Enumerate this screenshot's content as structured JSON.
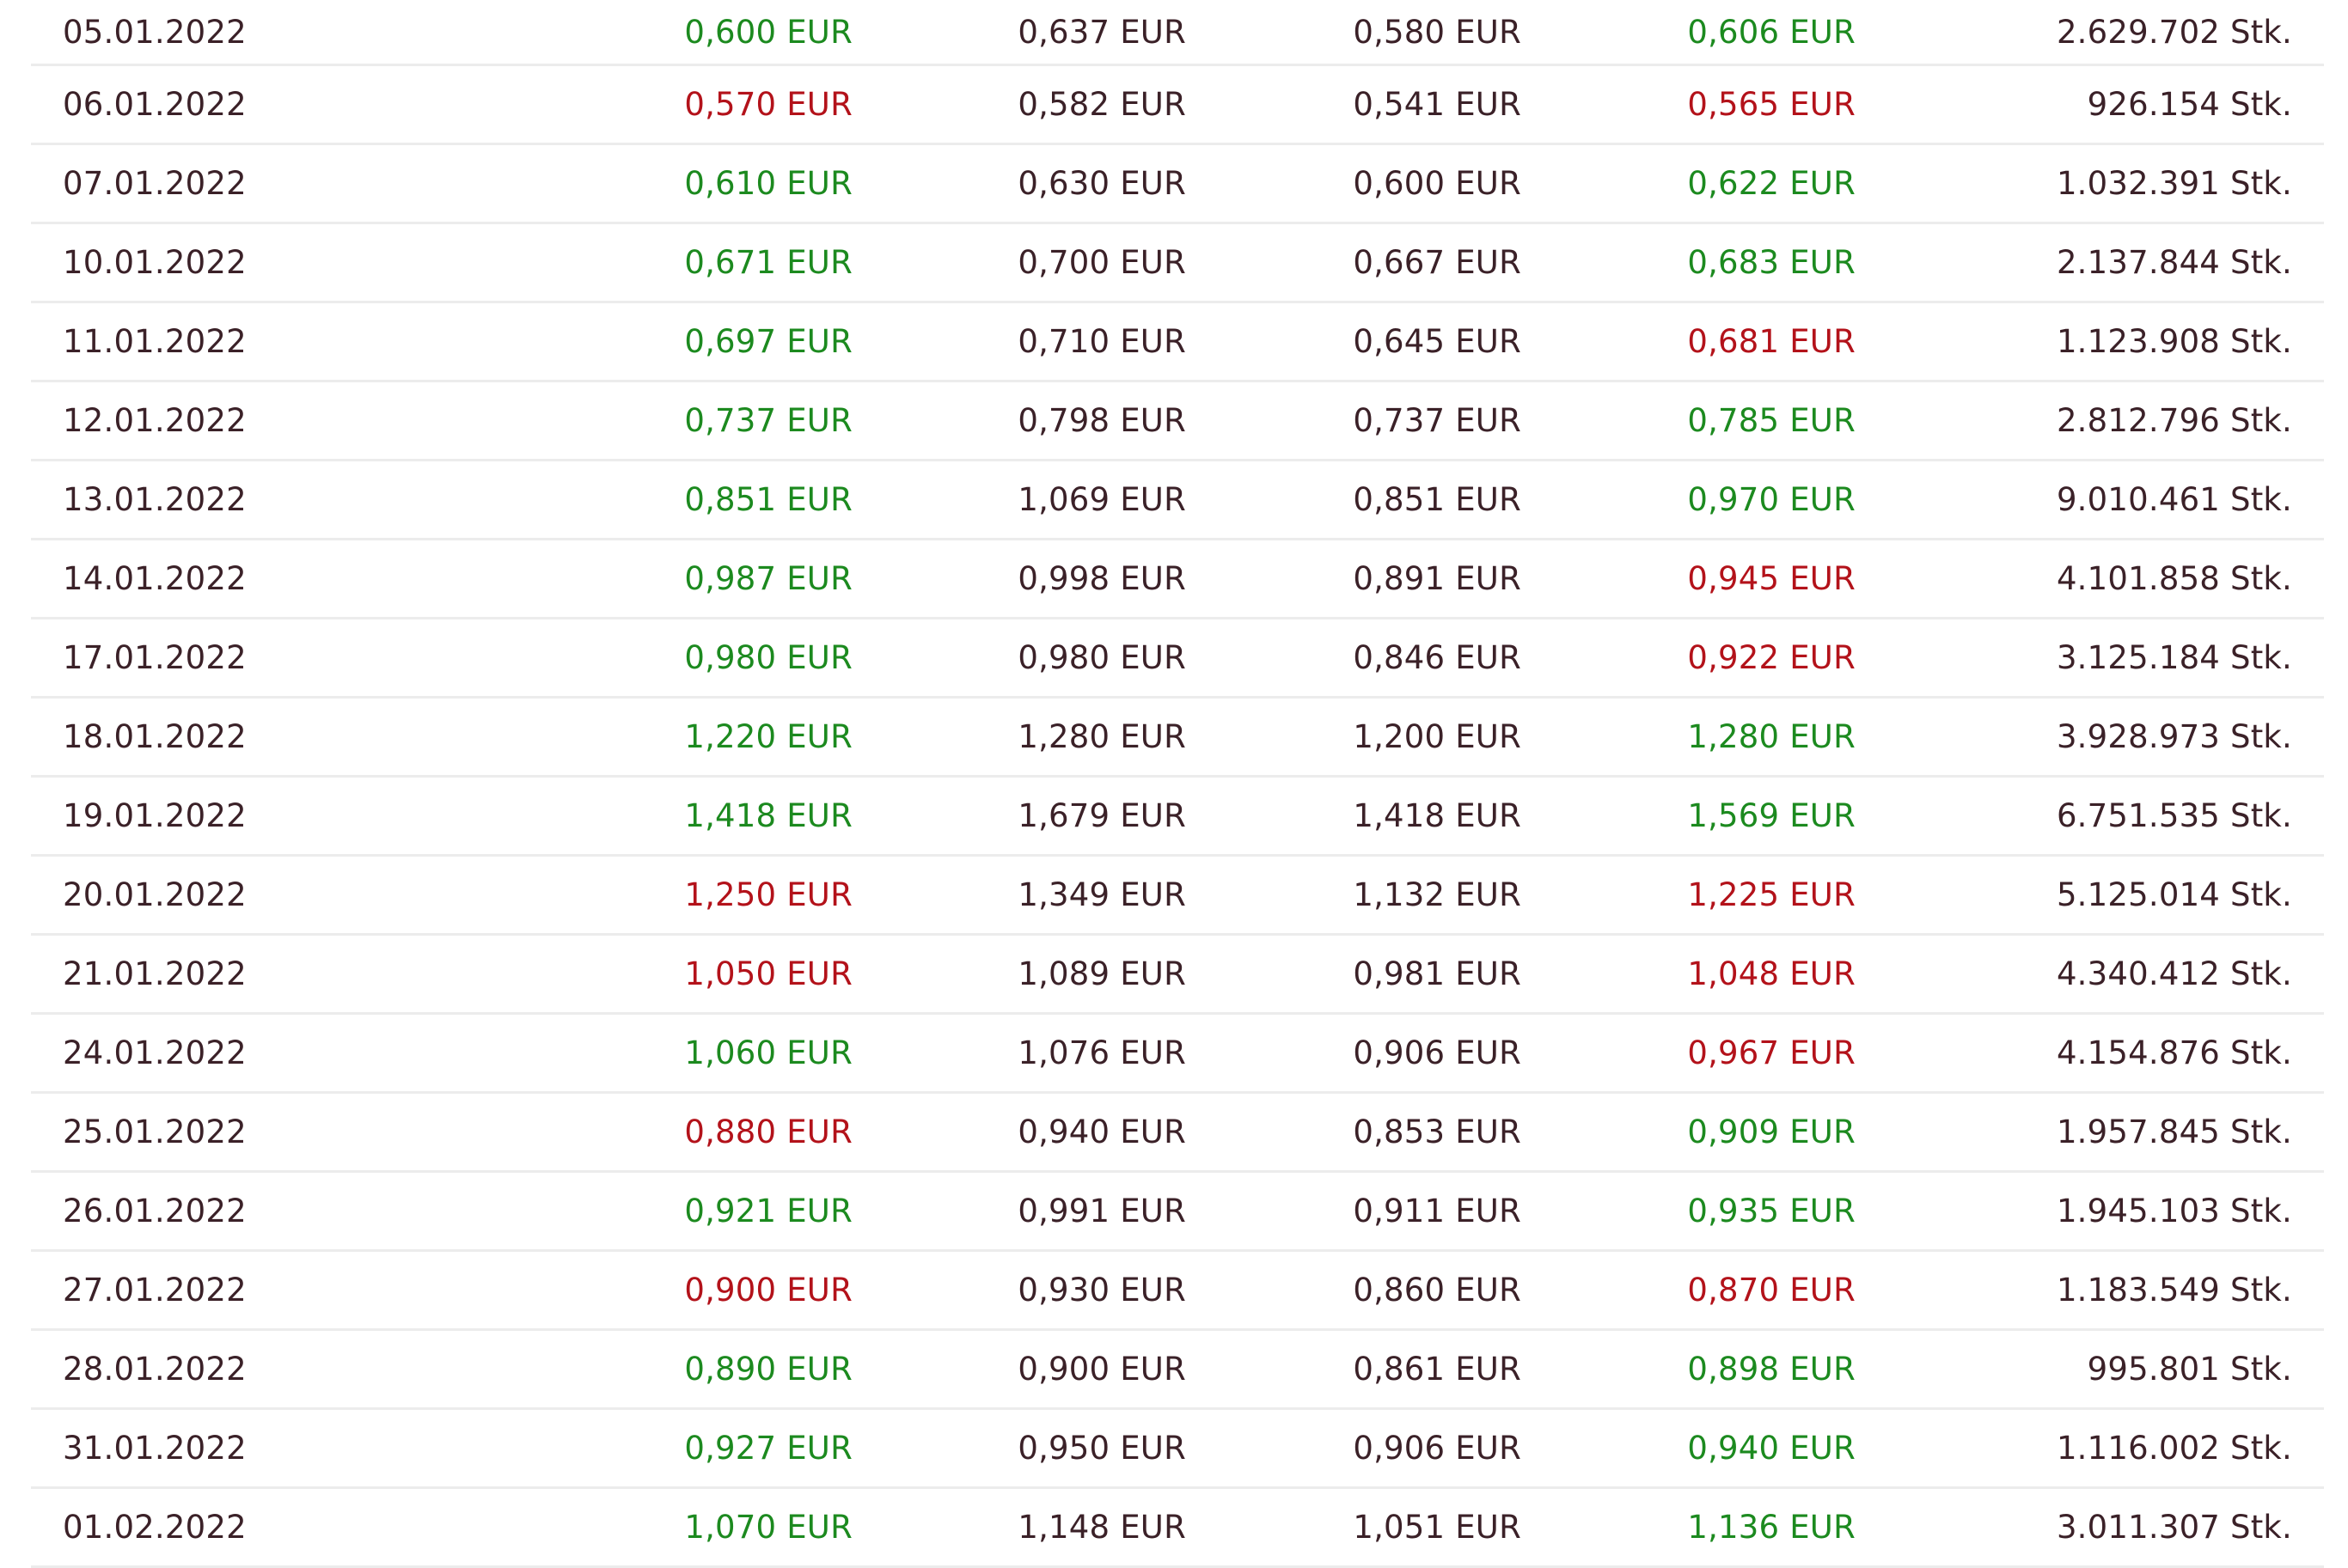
{
  "colors": {
    "positive": "#1c8a1f",
    "negative": "#b3121a",
    "text": "#3b2128",
    "divider": "#ececec"
  },
  "rows": [
    {
      "date": "05.01.2022",
      "open": "0,600 EUR",
      "open_trend": "up",
      "high": "0,637 EUR",
      "low": "0,580 EUR",
      "close": "0,606 EUR",
      "close_trend": "up",
      "volume": "2.629.702 Stk."
    },
    {
      "date": "06.01.2022",
      "open": "0,570 EUR",
      "open_trend": "down",
      "high": "0,582 EUR",
      "low": "0,541 EUR",
      "close": "0,565 EUR",
      "close_trend": "down",
      "volume": "926.154 Stk."
    },
    {
      "date": "07.01.2022",
      "open": "0,610 EUR",
      "open_trend": "up",
      "high": "0,630 EUR",
      "low": "0,600 EUR",
      "close": "0,622 EUR",
      "close_trend": "up",
      "volume": "1.032.391 Stk."
    },
    {
      "date": "10.01.2022",
      "open": "0,671 EUR",
      "open_trend": "up",
      "high": "0,700 EUR",
      "low": "0,667 EUR",
      "close": "0,683 EUR",
      "close_trend": "up",
      "volume": "2.137.844 Stk."
    },
    {
      "date": "11.01.2022",
      "open": "0,697 EUR",
      "open_trend": "up",
      "high": "0,710 EUR",
      "low": "0,645 EUR",
      "close": "0,681 EUR",
      "close_trend": "down",
      "volume": "1.123.908 Stk."
    },
    {
      "date": "12.01.2022",
      "open": "0,737 EUR",
      "open_trend": "up",
      "high": "0,798 EUR",
      "low": "0,737 EUR",
      "close": "0,785 EUR",
      "close_trend": "up",
      "volume": "2.812.796 Stk."
    },
    {
      "date": "13.01.2022",
      "open": "0,851 EUR",
      "open_trend": "up",
      "high": "1,069 EUR",
      "low": "0,851 EUR",
      "close": "0,970 EUR",
      "close_trend": "up",
      "volume": "9.010.461 Stk."
    },
    {
      "date": "14.01.2022",
      "open": "0,987 EUR",
      "open_trend": "up",
      "high": "0,998 EUR",
      "low": "0,891 EUR",
      "close": "0,945 EUR",
      "close_trend": "down",
      "volume": "4.101.858 Stk."
    },
    {
      "date": "17.01.2022",
      "open": "0,980 EUR",
      "open_trend": "up",
      "high": "0,980 EUR",
      "low": "0,846 EUR",
      "close": "0,922 EUR",
      "close_trend": "down",
      "volume": "3.125.184 Stk."
    },
    {
      "date": "18.01.2022",
      "open": "1,220 EUR",
      "open_trend": "up",
      "high": "1,280 EUR",
      "low": "1,200 EUR",
      "close": "1,280 EUR",
      "close_trend": "up",
      "volume": "3.928.973 Stk."
    },
    {
      "date": "19.01.2022",
      "open": "1,418 EUR",
      "open_trend": "up",
      "high": "1,679 EUR",
      "low": "1,418 EUR",
      "close": "1,569 EUR",
      "close_trend": "up",
      "volume": "6.751.535 Stk."
    },
    {
      "date": "20.01.2022",
      "open": "1,250 EUR",
      "open_trend": "down",
      "high": "1,349 EUR",
      "low": "1,132 EUR",
      "close": "1,225 EUR",
      "close_trend": "down",
      "volume": "5.125.014 Stk."
    },
    {
      "date": "21.01.2022",
      "open": "1,050 EUR",
      "open_trend": "down",
      "high": "1,089 EUR",
      "low": "0,981 EUR",
      "close": "1,048 EUR",
      "close_trend": "down",
      "volume": "4.340.412 Stk."
    },
    {
      "date": "24.01.2022",
      "open": "1,060 EUR",
      "open_trend": "up",
      "high": "1,076 EUR",
      "low": "0,906 EUR",
      "close": "0,967 EUR",
      "close_trend": "down",
      "volume": "4.154.876 Stk."
    },
    {
      "date": "25.01.2022",
      "open": "0,880 EUR",
      "open_trend": "down",
      "high": "0,940 EUR",
      "low": "0,853 EUR",
      "close": "0,909 EUR",
      "close_trend": "up",
      "volume": "1.957.845 Stk."
    },
    {
      "date": "26.01.2022",
      "open": "0,921 EUR",
      "open_trend": "up",
      "high": "0,991 EUR",
      "low": "0,911 EUR",
      "close": "0,935 EUR",
      "close_trend": "up",
      "volume": "1.945.103 Stk."
    },
    {
      "date": "27.01.2022",
      "open": "0,900 EUR",
      "open_trend": "down",
      "high": "0,930 EUR",
      "low": "0,860 EUR",
      "close": "0,870 EUR",
      "close_trend": "down",
      "volume": "1.183.549 Stk."
    },
    {
      "date": "28.01.2022",
      "open": "0,890 EUR",
      "open_trend": "up",
      "high": "0,900 EUR",
      "low": "0,861 EUR",
      "close": "0,898 EUR",
      "close_trend": "up",
      "volume": "995.801 Stk."
    },
    {
      "date": "31.01.2022",
      "open": "0,927 EUR",
      "open_trend": "up",
      "high": "0,950 EUR",
      "low": "0,906 EUR",
      "close": "0,940 EUR",
      "close_trend": "up",
      "volume": "1.116.002 Stk."
    },
    {
      "date": "01.02.2022",
      "open": "1,070 EUR",
      "open_trend": "up",
      "high": "1,148 EUR",
      "low": "1,051 EUR",
      "close": "1,136 EUR",
      "close_trend": "up",
      "volume": "3.011.307 Stk."
    }
  ]
}
